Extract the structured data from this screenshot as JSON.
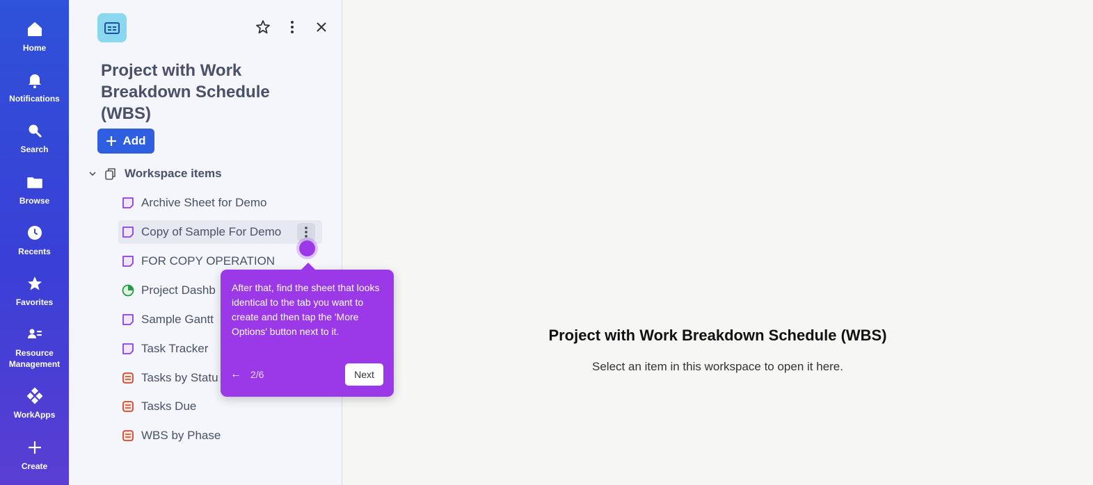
{
  "rail": {
    "items": [
      {
        "label": "Home",
        "icon": "home-icon"
      },
      {
        "label": "Notifications",
        "icon": "bell-icon"
      },
      {
        "label": "Search",
        "icon": "search-icon"
      },
      {
        "label": "Browse",
        "icon": "folder-icon"
      },
      {
        "label": "Recents",
        "icon": "clock-icon"
      },
      {
        "label": "Favorites",
        "icon": "star-icon"
      },
      {
        "label": "Resource Management",
        "icon": "people-icon"
      },
      {
        "label": "WorkApps",
        "icon": "workapps-icon"
      },
      {
        "label": "Create",
        "icon": "plus-icon"
      }
    ]
  },
  "panel": {
    "title": "Project with Work Breakdown Schedule (WBS)",
    "add_label": "Add",
    "section_label": "Workspace items",
    "items": [
      {
        "label": "Archive Sheet for Demo",
        "type": "sheet"
      },
      {
        "label": "Copy of Sample For Demo",
        "type": "sheet"
      },
      {
        "label": "FOR COPY OPERATION",
        "type": "sheet"
      },
      {
        "label": "Project Dashb",
        "type": "dashboard"
      },
      {
        "label": "Sample Gantt",
        "type": "sheet"
      },
      {
        "label": "Task Tracker",
        "type": "sheet"
      },
      {
        "label": "Tasks by Statu",
        "type": "report"
      },
      {
        "label": "Tasks Due",
        "type": "report"
      },
      {
        "label": "WBS by Phase",
        "type": "report"
      }
    ]
  },
  "tooltip": {
    "text": "After that, find the sheet that looks identical to the tab you want to create and then tap the 'More Options' button next to it.",
    "back": "←",
    "step": "2/6",
    "next_label": "Next"
  },
  "main": {
    "title": "Project with Work Breakdown Schedule (WBS)",
    "subtitle": "Select an item in this workspace to open it here."
  },
  "colors": {
    "rail_top": "#2e52d9",
    "rail_bottom": "#5a3ed3",
    "accent": "#2f5fe0",
    "tooltip": "#9b39e8"
  }
}
